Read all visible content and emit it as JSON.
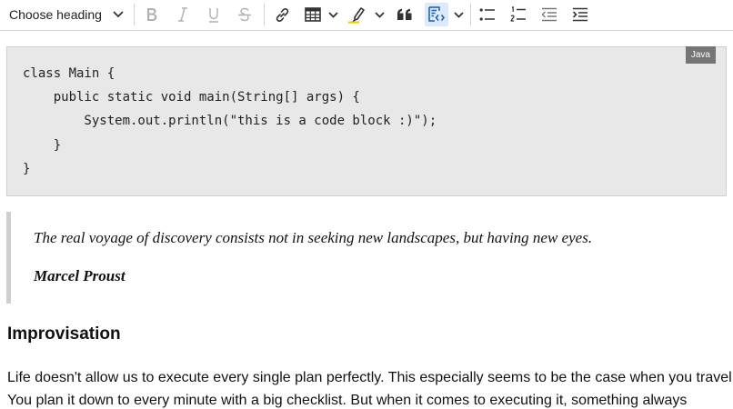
{
  "toolbar": {
    "heading_select_label": "Choose heading",
    "icons": [
      "bold-icon",
      "italic-icon",
      "underline-icon",
      "strikethrough-icon",
      "link-icon",
      "table-icon",
      "highlight-icon",
      "blockquote-icon",
      "code-block-icon",
      "bulleted-list-icon",
      "numbered-list-icon",
      "outdent-icon",
      "indent-icon"
    ],
    "colors": {
      "disabled": "#b0b0b0",
      "active_bg": "#dce9f8",
      "highlight_pen": "#e6d300"
    }
  },
  "code_block": {
    "language": "Java",
    "lines": [
      "class Main {",
      "    public static void main(String[] args) {",
      "        System.out.println(\"this is a code block :)\");",
      "    }",
      "}"
    ]
  },
  "blockquote": {
    "text": "The real voyage of discovery consists not in seeking new landscapes, but having new eyes.",
    "author": "Marcel Proust"
  },
  "section": {
    "heading": "Improvisation",
    "paragraph_line_1": "Life doesn't allow us to execute every single plan perfectly. This especially seems to be the case when you travel.",
    "paragraph_line_2": "You plan it down to every minute with a big checklist. But when it comes to executing it, something always"
  }
}
